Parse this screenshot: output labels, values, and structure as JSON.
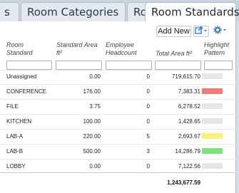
{
  "tabs": [
    {
      "label": "s",
      "active": false
    },
    {
      "label": "Room Categories",
      "active": false
    },
    {
      "label": "Rooms",
      "active": false
    },
    {
      "label": "Room Standards",
      "active": true
    }
  ],
  "toolbar": {
    "add_label": "Add New",
    "export_icon": "export-icon",
    "settings_icon": "gear-icon"
  },
  "columns": {
    "room_standard": "Room Standard",
    "standard_area": "Standard Area ft²",
    "employee_headcount": "Employee Headcount",
    "total_area": "Total Area ft²",
    "highlight_pattern": "Highlight Pattern"
  },
  "rows": [
    {
      "name": "Unassigned",
      "area": "0.00",
      "headcount": "0",
      "total": "719,615.70",
      "color": "#e6e6e6"
    },
    {
      "name": "CONFERENCE",
      "area": "176.00",
      "headcount": "0",
      "total": "7,383.31",
      "color": "#f07a7a"
    },
    {
      "name": "FILE",
      "area": "3.75",
      "headcount": "0",
      "total": "6,278.52",
      "color": "#e6e6e6"
    },
    {
      "name": "KITCHEN",
      "area": "100.00",
      "headcount": "0",
      "total": "1,428.65",
      "color": "#e6e6e6"
    },
    {
      "name": "LAB-A",
      "area": "220.00",
      "headcount": "5",
      "total": "2,693.67",
      "color": "#f7f27a"
    },
    {
      "name": "LAB-B",
      "area": "500.00",
      "headcount": "3",
      "total": "14,286.79",
      "color": "#7ee07e"
    },
    {
      "name": "LOBBY",
      "area": "0.00",
      "headcount": "0",
      "total": "7,122.56",
      "color": "#e6e6e6"
    }
  ],
  "total_area_sum": "1,243,677.59"
}
